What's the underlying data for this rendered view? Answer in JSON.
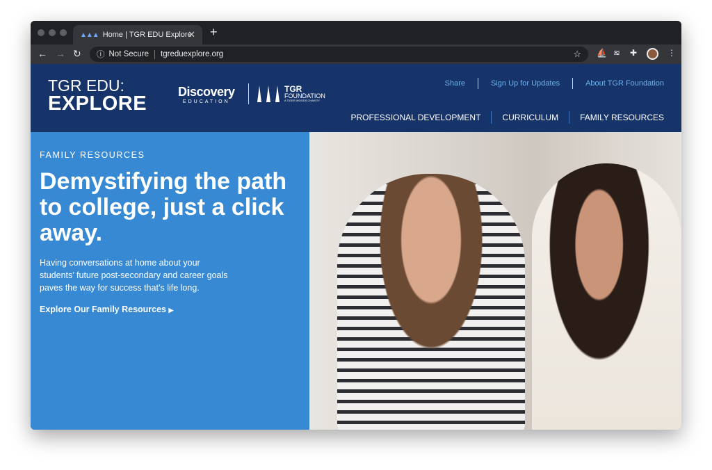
{
  "browser": {
    "tab_title": "Home | TGR EDU Explore",
    "security": "Not Secure",
    "url": "tgreduexplore.org"
  },
  "header": {
    "logo_line1": "TGR EDU:",
    "logo_line2": "EXPLORE",
    "partner1": {
      "name": "Discovery",
      "sub": "EDUCATION"
    },
    "partner2": {
      "name": "TGR",
      "sub": "FOUNDATION",
      "tagline": "A TIGER WOODS CHARITY"
    },
    "utility_links": [
      "Share",
      "Sign Up for Updates",
      "About TGR Foundation"
    ],
    "main_nav": [
      "PROFESSIONAL DEVELOPMENT",
      "CURRICULUM",
      "FAMILY RESOURCES"
    ]
  },
  "hero": {
    "eyebrow": "FAMILY RESOURCES",
    "headline": "Demystifying the path to college, just a click away.",
    "body": "Having conversations at home about your students’ future post-secondary and career goals paves the way for success that’s life long.",
    "cta": "Explore Our Family Resources"
  },
  "colors": {
    "header": "#17346a",
    "hero_panel": "#3789d4",
    "utility_link": "#6fb0ee"
  }
}
